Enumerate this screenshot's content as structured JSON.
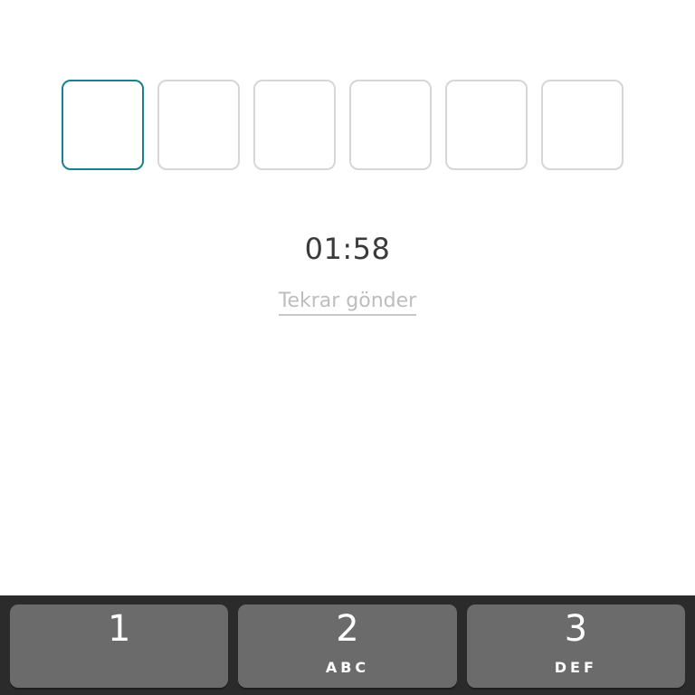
{
  "otp": {
    "digits": [
      "",
      "",
      "",
      "",
      "",
      ""
    ],
    "active_index": 0,
    "active_color": "#1a7f8e",
    "border_color": "#d6d6d6"
  },
  "timer": {
    "text": "01:58"
  },
  "resend": {
    "label": "Tekrar gönder"
  },
  "keyboard": {
    "keys": [
      {
        "digit": "1",
        "letters": ""
      },
      {
        "digit": "2",
        "letters": "ABC"
      },
      {
        "digit": "3",
        "letters": "DEF"
      }
    ]
  }
}
